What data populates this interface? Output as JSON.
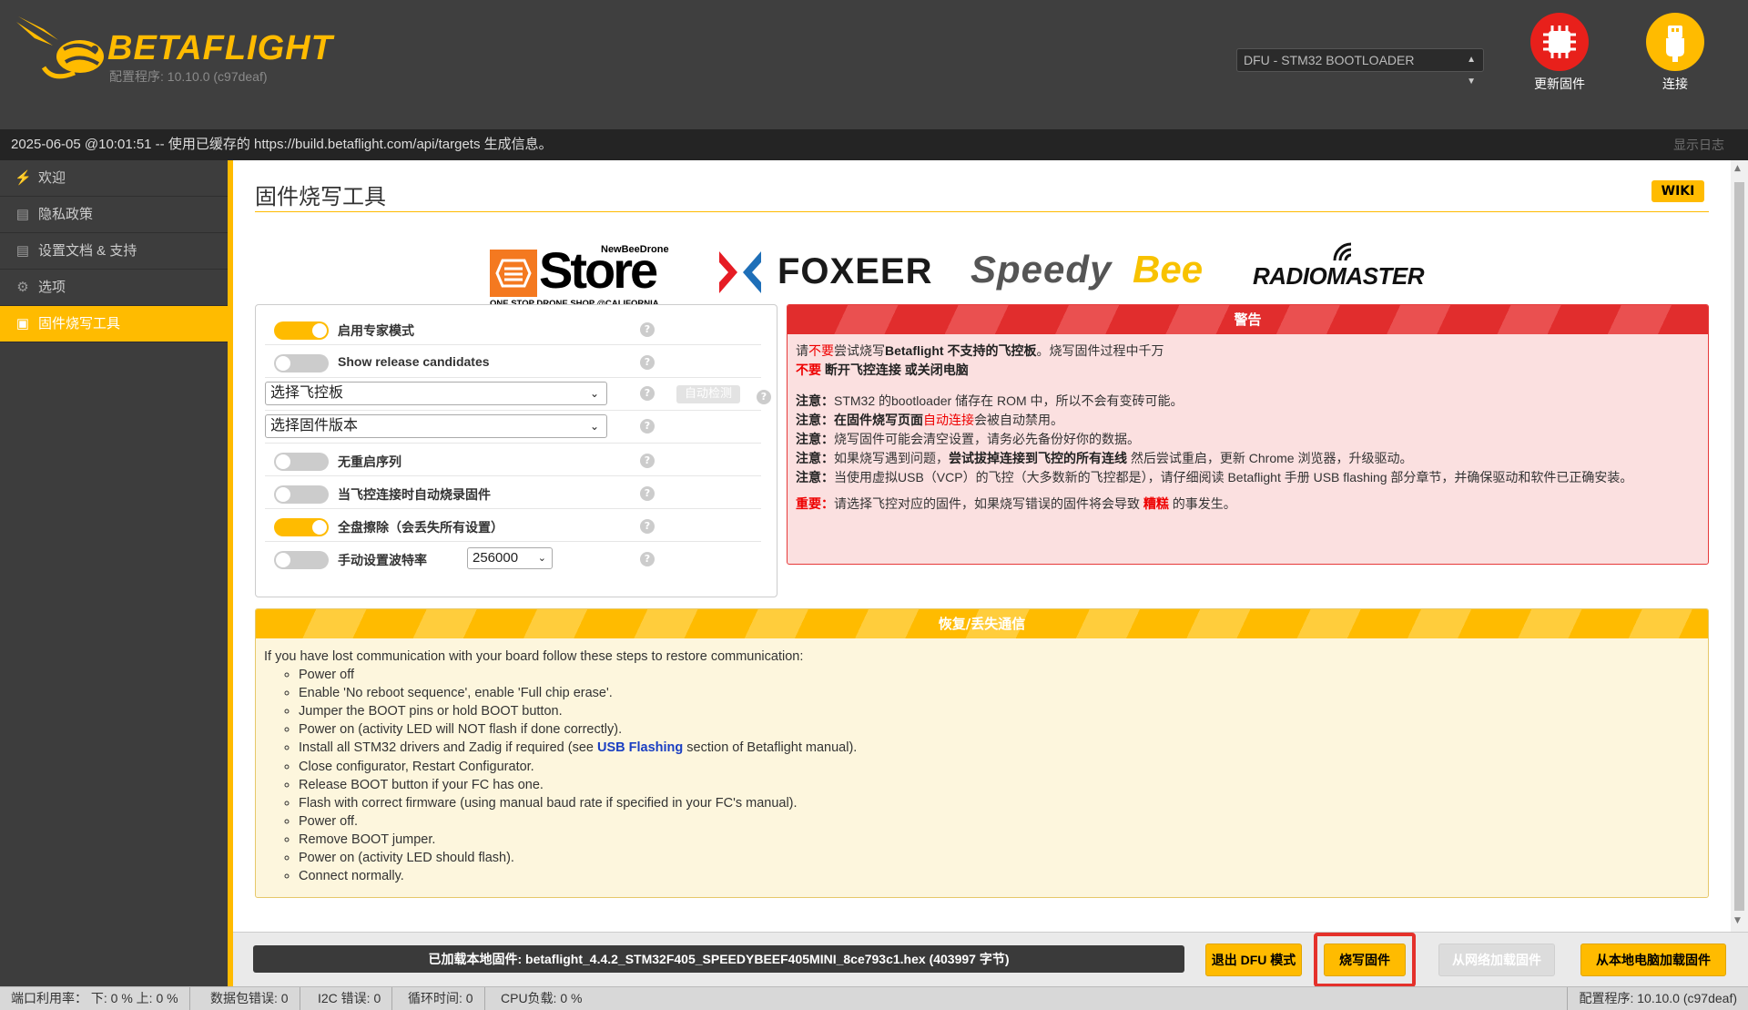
{
  "header": {
    "app_name_1": "BETA",
    "app_name_2": "FLIGHT",
    "version": "配置程序: 10.10.0 (c97deaf)",
    "port_select": "DFU - STM32 BOOTLOADER",
    "flash_button": "更新固件",
    "connect_button": "连接"
  },
  "logbar": {
    "message": "2025-06-05 @10:01:51 -- 使用已缓存的 https://build.betaflight.com/api/targets 生成信息。",
    "show_log": "显示日志"
  },
  "sidebar": {
    "items": [
      {
        "label": "欢迎",
        "icon": "plug-icon"
      },
      {
        "label": "隐私政策",
        "icon": "document-icon"
      },
      {
        "label": "设置文档 & 支持",
        "icon": "document-icon"
      },
      {
        "label": "选项",
        "icon": "gear-icon"
      },
      {
        "label": "固件烧写工具",
        "icon": "chip-icon",
        "active": true
      }
    ]
  },
  "main": {
    "title": "固件烧写工具",
    "wiki": "WIKI",
    "sponsors": {
      "store_brand": "NewBeeDrone",
      "store_name": "Store",
      "store_tagline": "ONE STOP DRONE SHOP @CALIFORNIA",
      "foxeer": "FOXEER",
      "speedybee_1": "Speedy",
      "speedybee_2": "Bee",
      "radiomaster": "RADIOMASTER"
    },
    "options": {
      "expert_mode": "启用专家模式",
      "release_candidates": "Show release candidates",
      "select_board": "选择飞控板",
      "auto_detect": "自动检测",
      "select_firmware": "选择固件版本",
      "no_reboot": "无重启序列",
      "auto_flash_on_connect": "当飞控连接时自动烧录固件",
      "full_erase": "全盘擦除（会丢失所有设置）",
      "manual_baud": "手动设置波特率",
      "baud_value": "256000"
    },
    "warning": {
      "title": "警告",
      "l1_a": "请",
      "l1_b": "不要",
      "l1_c": "尝试烧写",
      "l1_d": "Betaflight 不支持的飞控板",
      "l1_e": "。烧写固件过程中千万",
      "l2_a": "不要",
      "l2_b": " 断开飞控连接 或关闭电脑",
      "note": "注意：",
      "n1": "STM32 的bootloader 储存在 ROM 中，所以不会有变砖可能。",
      "n2_a": "在固件烧写页面",
      "n2_b": "自动连接",
      "n2_c": "会被自动禁用。",
      "n3": "烧写固件可能会清空设置，请务必先备份好你的数据。",
      "n4_a": "如果烧写遇到问题，",
      "n4_b": "尝试拔掉连接到飞控的所有连线",
      "n4_c": " 然后尝试重启，更新 Chrome 浏览器，升级驱动。",
      "n5": "当使用虚拟USB（VCP）的飞控（大多数新的飞控都是），请仔细阅读 Betaflight 手册 USB flashing 部分章节，并确保驱动和软件已正确安装。",
      "imp_label": "重要：",
      "imp_a": "请选择飞控对应的固件，如果烧写错误的固件将会导致 ",
      "imp_b": "糟糕",
      "imp_c": " 的事发生。"
    },
    "recovery": {
      "title": "恢复/丢失通信",
      "intro": "If you have lost communication with your board follow these steps to restore communication:",
      "steps": [
        "Power off",
        "Enable 'No reboot sequence', enable 'Full chip erase'.",
        "Jumper the BOOT pins or hold BOOT button.",
        "Power on (activity LED will NOT flash if done correctly).",
        "Install all STM32 drivers and Zadig if required (see ",
        "Close configurator, Restart Configurator.",
        "Release BOOT button if your FC has one.",
        "Flash with correct firmware (using manual baud rate if specified in your FC's manual).",
        "Power off.",
        "Remove BOOT jumper.",
        "Power on (activity LED should flash).",
        "Connect normally."
      ],
      "step5_link": "USB Flashing",
      "step5_tail": " section of Betaflight manual)."
    }
  },
  "bottom": {
    "loaded_firmware": "已加载本地固件: betaflight_4.4.2_STM32F405_SPEEDYBEEF405MINI_8ce793c1.hex (403997 字节)",
    "exit_dfu": "退出 DFU 模式",
    "flash_firmware": "烧写固件",
    "load_online": "从网络加载固件",
    "load_local": "从本地电脑加载固件"
  },
  "status": {
    "port_usage": "端口利用率： 下: 0 % 上: 0 %",
    "packet_errors": "数据包错误: 0",
    "i2c_errors": "I2C 错误: 0",
    "cycle_time": "循环时间: 0",
    "cpu_load": "CPU负载: 0 %",
    "configurator": "配置程序: 10.10.0 (c97deaf)"
  },
  "colors": {
    "accent": "#ffbb00",
    "warning": "#e12d2d",
    "flash_button": "#e8201b"
  }
}
